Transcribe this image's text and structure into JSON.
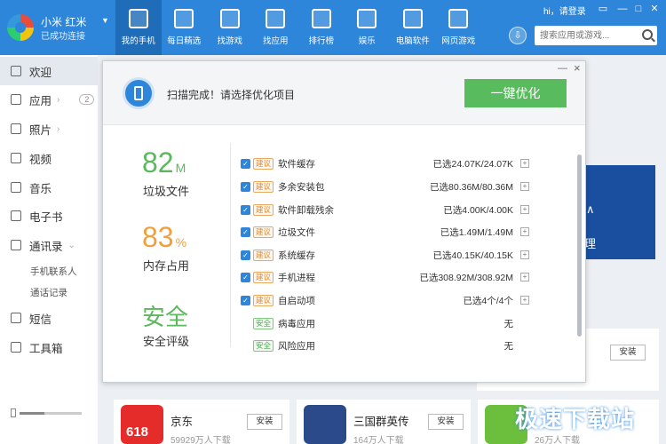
{
  "device": {
    "name": "小米 红米",
    "status": "已成功连接"
  },
  "nav": [
    {
      "label": "我的手机",
      "icon": "phone-icon"
    },
    {
      "label": "每日精选",
      "icon": "calendar-icon"
    },
    {
      "label": "找游戏",
      "icon": "gamepad-icon"
    },
    {
      "label": "找应用",
      "icon": "bag-icon"
    },
    {
      "label": "排行榜",
      "icon": "medal-icon"
    },
    {
      "label": "娱乐",
      "icon": "cloud-icon"
    },
    {
      "label": "电脑软件",
      "icon": "monitor-icon"
    },
    {
      "label": "网页游戏",
      "icon": "web-game-icon"
    }
  ],
  "header": {
    "login": "hi，请登录",
    "search_placeholder": "搜索应用或游戏..."
  },
  "sidebar": {
    "items": [
      {
        "label": "欢迎",
        "icon": "welcome-icon"
      },
      {
        "label": "应用",
        "icon": "apps-icon",
        "badge": "2"
      },
      {
        "label": "照片",
        "icon": "photo-icon"
      },
      {
        "label": "视频",
        "icon": "video-icon"
      },
      {
        "label": "音乐",
        "icon": "music-icon"
      },
      {
        "label": "电子书",
        "icon": "book-icon"
      },
      {
        "label": "通讯录",
        "icon": "contacts-icon"
      },
      {
        "label": "短信",
        "icon": "sms-icon"
      },
      {
        "label": "工具箱",
        "icon": "toolbox-icon"
      }
    ],
    "sub": [
      "手机联系人",
      "通话记录"
    ]
  },
  "dialog": {
    "scan_text": "扫描完成！请选择优化项目",
    "optimize_label": "一键优化",
    "stats": [
      {
        "value": "82",
        "unit": "M",
        "label": "垃圾文件",
        "color": "#5cb85c"
      },
      {
        "value": "83",
        "unit": "%",
        "label": "内存占用",
        "color": "#f0a03c"
      },
      {
        "value": "安全",
        "unit": "",
        "label": "安全评级",
        "color": "#5cb85c"
      }
    ],
    "rows": [
      {
        "tag": "建议",
        "name": "软件缓存",
        "value": "已选24.07K/24.07K",
        "checked": true
      },
      {
        "tag": "建议",
        "name": "多余安装包",
        "value": "已选80.36M/80.36M",
        "checked": true
      },
      {
        "tag": "建议",
        "name": "软件卸载残余",
        "value": "已选4.00K/4.00K",
        "checked": true
      },
      {
        "tag": "建议",
        "name": "垃圾文件",
        "value": "已选1.49M/1.49M",
        "checked": true
      },
      {
        "tag": "建议",
        "name": "系统缓存",
        "value": "已选40.15K/40.15K",
        "checked": true
      },
      {
        "tag": "建议",
        "name": "手机进程",
        "value": "已选308.92M/308.92M",
        "checked": true
      },
      {
        "tag": "建议",
        "name": "自启动项",
        "value": "已选4个/4个",
        "checked": true
      },
      {
        "tag": "安全",
        "name": "病毒应用",
        "value": "无",
        "checked": false
      },
      {
        "tag": "安全",
        "name": "风险应用",
        "value": "无",
        "checked": false
      }
    ]
  },
  "bg": {
    "install": "安装",
    "apps": [
      {
        "name": "京东",
        "sub": "59929万人下载"
      },
      {
        "name": "三国群英传",
        "sub": "164万人下载"
      },
      {
        "name": "",
        "sub": "26万人下载"
      }
    ],
    "promo_badge": "618",
    "banner_fragment": "理",
    "watermark": "极速下载站"
  }
}
